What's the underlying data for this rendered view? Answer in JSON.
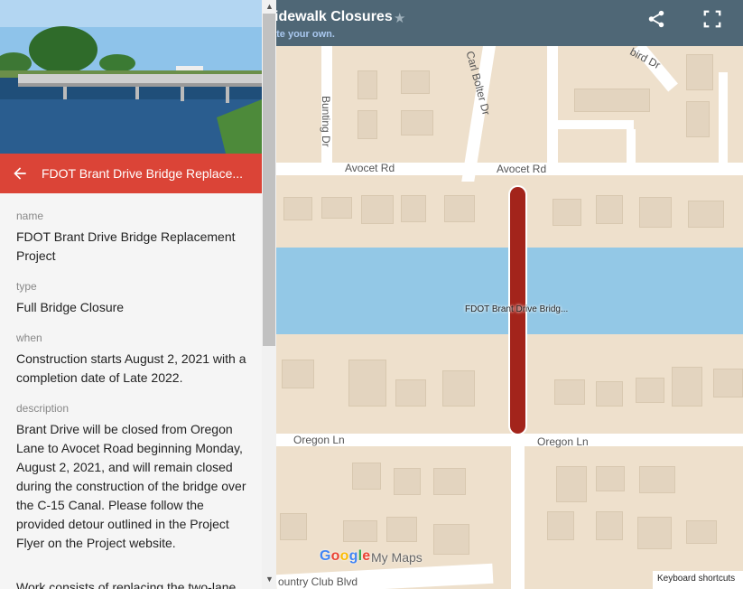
{
  "header": {
    "title": "idewalk Closures",
    "subtitle": "ate your own."
  },
  "panel": {
    "title": "FDOT Brant Drive Bridge Replace...",
    "fields": [
      {
        "label": "name",
        "value": "FDOT Brant Drive Bridge Replacement Project"
      },
      {
        "label": "type",
        "value": "Full Bridge Closure"
      },
      {
        "label": "when",
        "value": "Construction starts August 2, 2021 with a completion date of Late 2022."
      },
      {
        "label": "description",
        "value": "Brant Drive will be closed from Oregon Lane to Avocet Road beginning Monday, August 2, 2021, and will remain closed during the construction of the bridge over the C-15 Canal. Please follow the provided detour outlined in the Project Flyer on the Project website."
      },
      {
        "label": "",
        "value": "Work consists of replacing the two-lane"
      }
    ]
  },
  "map": {
    "roads": {
      "avocet_left": "Avocet Rd",
      "avocet_right": "Avocet Rd",
      "oregon_left": "Oregon Ln",
      "oregon_right": "Oregon Ln",
      "bunting": "Bunting Dr",
      "carl_bolter": "Carl Bolter Dr",
      "bird": "bird Dr",
      "country_club": "ountry Club Blvd"
    },
    "feature_label": "FDOT Brant Drive Bridg...",
    "feature_color": "#a3241b",
    "water_color": "#93c8e6"
  },
  "branding": {
    "google": "Google",
    "mymaps": "My Maps",
    "keyboard": "Keyboard shortcuts"
  },
  "colors": {
    "header_bg": "#4f6776",
    "panel_head_bg": "#db4437"
  }
}
